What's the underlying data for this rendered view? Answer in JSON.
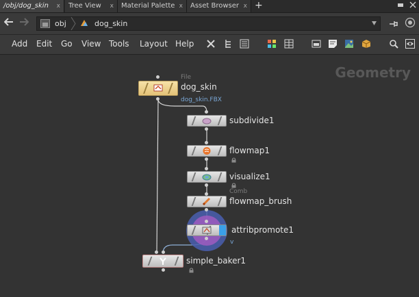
{
  "tabs": [
    {
      "label": "/obj/dog_skin",
      "active": true
    },
    {
      "label": "Tree View",
      "active": false
    },
    {
      "label": "Material Palette",
      "active": false
    },
    {
      "label": "Asset Browser",
      "active": false
    }
  ],
  "tab_close": "x",
  "tab_add": "+",
  "path": {
    "root": "obj",
    "current": "dog_skin"
  },
  "menu": [
    "Add",
    "Edit",
    "Go",
    "View",
    "Tools",
    "Layout",
    "Help"
  ],
  "context_label": "Geometry",
  "nodes": {
    "dog_skin": {
      "label": "dog_skin",
      "type_label": "File",
      "sublabel": "dog_skin.FBX"
    },
    "subdivide1": {
      "label": "subdivide1"
    },
    "flowmap1": {
      "label": "flowmap1"
    },
    "visualize1": {
      "label": "visualize1",
      "extra": "Comb"
    },
    "flowmap_brush": {
      "label": "flowmap_brush"
    },
    "attribpromote1": {
      "label": "attribpromote1",
      "sublabel": "v"
    },
    "simple_baker1": {
      "label": "simple_baker1"
    }
  },
  "colors": {
    "selected_node": "#f0d79a",
    "wire": "#d6d6d6",
    "wire_blue": "#8fb0d8",
    "accent_blue": "#3aa0e8"
  }
}
